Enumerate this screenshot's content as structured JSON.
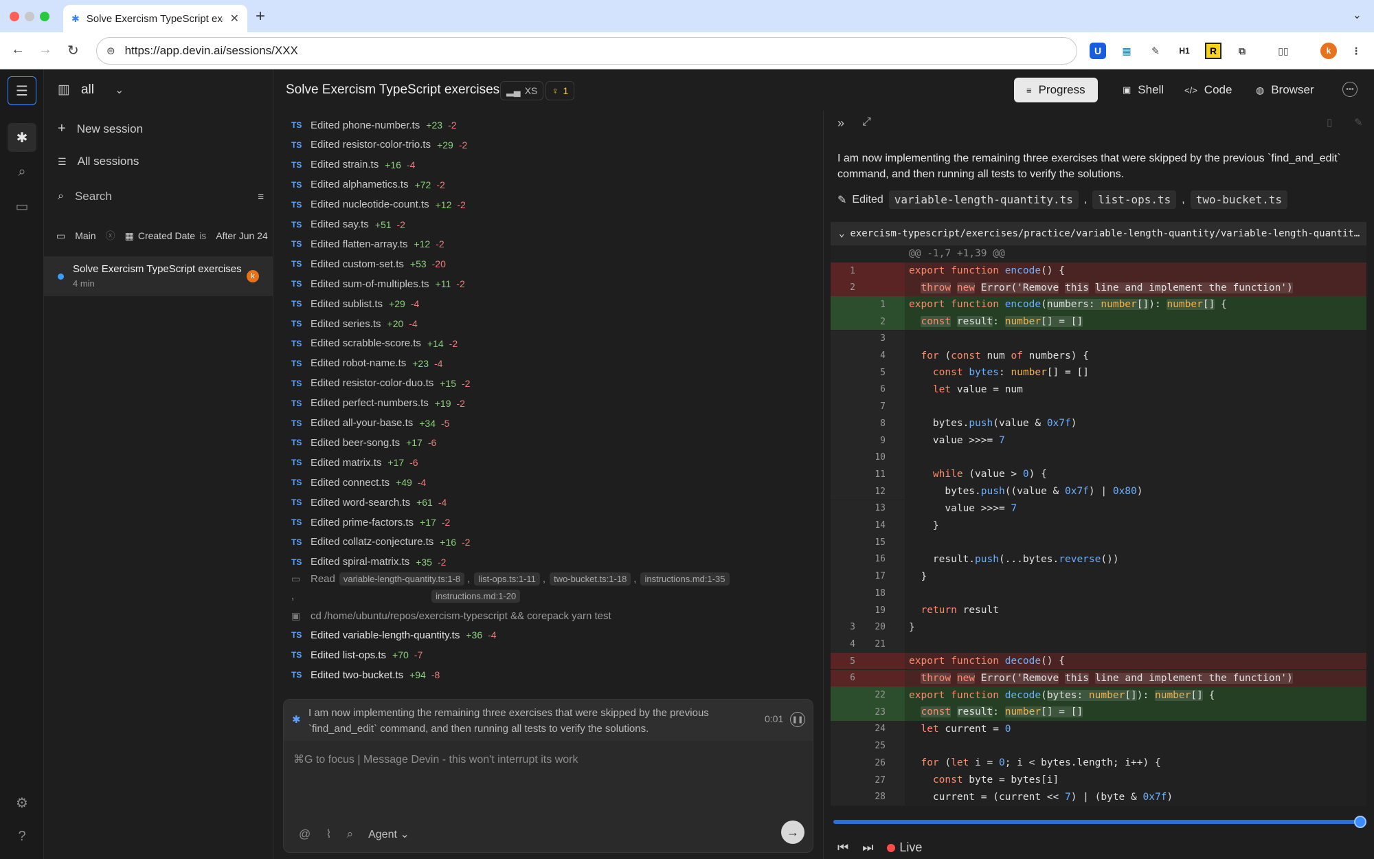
{
  "browser": {
    "tab_title": "Solve Exercism TypeScript exercises",
    "url": "https://app.devin.ai/sessions/XXX",
    "new_tab": "+",
    "profile_initial": "k"
  },
  "sidebar": {
    "workspace": "all",
    "new_session": "New session",
    "all_sessions": "All sessions",
    "search_placeholder": "Search",
    "filter_branch": "Main",
    "filter_field": "Created Date",
    "filter_op": "is",
    "filter_value": "After Jun 24",
    "session": {
      "title": "Solve Exercism TypeScript exercises",
      "age": "4 min",
      "avatar": "k"
    }
  },
  "header": {
    "title": "Solve Exercism TypeScript exercises",
    "size_chip": "XS",
    "idea_count": "1",
    "tabs": [
      "Progress",
      "Shell",
      "Code",
      "Browser"
    ]
  },
  "feed": {
    "edits": [
      {
        "file": "Edited phone-number.ts",
        "add": "+23",
        "del": "-2"
      },
      {
        "file": "Edited resistor-color-trio.ts",
        "add": "+29",
        "del": "-2"
      },
      {
        "file": "Edited strain.ts",
        "add": "+16",
        "del": "-4"
      },
      {
        "file": "Edited alphametics.ts",
        "add": "+72",
        "del": "-2"
      },
      {
        "file": "Edited nucleotide-count.ts",
        "add": "+12",
        "del": "-2"
      },
      {
        "file": "Edited say.ts",
        "add": "+51",
        "del": "-2"
      },
      {
        "file": "Edited flatten-array.ts",
        "add": "+12",
        "del": "-2"
      },
      {
        "file": "Edited custom-set.ts",
        "add": "+53",
        "del": "-20"
      },
      {
        "file": "Edited sum-of-multiples.ts",
        "add": "+11",
        "del": "-2"
      },
      {
        "file": "Edited sublist.ts",
        "add": "+29",
        "del": "-4"
      },
      {
        "file": "Edited series.ts",
        "add": "+20",
        "del": "-4"
      },
      {
        "file": "Edited scrabble-score.ts",
        "add": "+14",
        "del": "-2"
      },
      {
        "file": "Edited robot-name.ts",
        "add": "+23",
        "del": "-4"
      },
      {
        "file": "Edited resistor-color-duo.ts",
        "add": "+15",
        "del": "-2"
      },
      {
        "file": "Edited perfect-numbers.ts",
        "add": "+19",
        "del": "-2"
      },
      {
        "file": "Edited all-your-base.ts",
        "add": "+34",
        "del": "-5"
      },
      {
        "file": "Edited beer-song.ts",
        "add": "+17",
        "del": "-6"
      },
      {
        "file": "Edited matrix.ts",
        "add": "+17",
        "del": "-6"
      },
      {
        "file": "Edited connect.ts",
        "add": "+49",
        "del": "-4"
      },
      {
        "file": "Edited word-search.ts",
        "add": "+61",
        "del": "-4"
      },
      {
        "file": "Edited prime-factors.ts",
        "add": "+17",
        "del": "-2"
      },
      {
        "file": "Edited collatz-conjecture.ts",
        "add": "+16",
        "del": "-2"
      },
      {
        "file": "Edited spiral-matrix.ts",
        "add": "+35",
        "del": "-2"
      }
    ],
    "read_label": "Read",
    "read_files": [
      "variable-length-quantity.ts:1-8",
      "list-ops.ts:1-11",
      "two-bucket.ts:1-18",
      "instructions.md:1-35",
      "instructions.md:1-20"
    ],
    "command": "cd /home/ubuntu/repos/exercism-typescript && corepack yarn test",
    "final_edits": [
      {
        "file": "Edited variable-length-quantity.ts",
        "add": "+36",
        "del": "-4"
      },
      {
        "file": "Edited list-ops.ts",
        "add": "+70",
        "del": "-7"
      },
      {
        "file": "Edited two-bucket.ts",
        "add": "+94",
        "del": "-8"
      }
    ]
  },
  "composer": {
    "status": "I am now implementing the remaining three exercises that were skipped by the previous `find_and_edit` command, and then running all tests to verify the solutions.",
    "timer": "0:01",
    "placeholder": "⌘G to focus | Message Devin - this won't interrupt its work",
    "agent_label": "Agent"
  },
  "panel": {
    "message": "I am now implementing the remaining three exercises that were skipped by the previous `find_and_edit` command, and then running all tests to verify the solutions.",
    "edited_label": "Edited",
    "edited_files": [
      "variable-length-quantity.ts",
      "list-ops.ts",
      "two-bucket.ts"
    ],
    "diff_path": "exercism-typescript/exercises/practice/variable-length-quantity/variable-length-quantit…",
    "hunk": "@@ -1,7 +1,39 @@",
    "live_label": "Live"
  }
}
